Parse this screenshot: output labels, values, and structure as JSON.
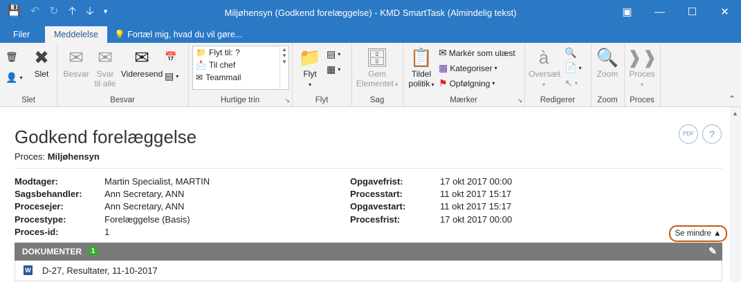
{
  "window": {
    "title": "Miljøhensyn (Godkend forelæggelse) - KMD SmartTask  (Almindelig tekst)"
  },
  "tabs": [
    {
      "label": "Filer"
    },
    {
      "label": "Meddelelse"
    }
  ],
  "tell_me": "Fortæl mig, hvad du vil gøre...",
  "ribbon": {
    "slet": {
      "delete_label": "Slet",
      "group": "Slet"
    },
    "besvar": {
      "reply": "Besvar",
      "reply_all_1": "Svar",
      "reply_all_2": "til alle",
      "forward": "Videresend",
      "group": "Besvar"
    },
    "hurtige": {
      "items": [
        "Flyt til: ?",
        "Til chef",
        "Teammail"
      ],
      "group": "Hurtige trin"
    },
    "flyt": {
      "move": "Flyt",
      "group": "Flyt"
    },
    "sag": {
      "save_1": "Gem",
      "save_2": "Elementet",
      "group": "Sag"
    },
    "maerker": {
      "policy_1": "Tildel",
      "policy_2": "politik",
      "mark_unread": "Markér som ulæst",
      "categorize": "Kategoriser",
      "followup": "Opfølgning",
      "group": "Mærker"
    },
    "rediger": {
      "translate": "Oversæt",
      "group": "Redigerer"
    },
    "zoom": {
      "label": "Zoom",
      "group": "Zoom"
    },
    "proces": {
      "label": "Proces",
      "group": "Proces"
    }
  },
  "task": {
    "title": "Godkend forelæggelse",
    "process_label": "Proces:",
    "process_value": "Miljøhensyn",
    "pdf_label": "PDF",
    "help_label": "?"
  },
  "details_left": [
    {
      "label": "Modtager:",
      "value": "Martin Specialist, MARTIN"
    },
    {
      "label": "Sagsbehandler:",
      "value": "Ann Secretary, ANN"
    },
    {
      "label": "Procesejer:",
      "value": "Ann Secretary, ANN"
    },
    {
      "label": "Procestype:",
      "value": "Forelæggelse (Basis)"
    },
    {
      "label": "Proces-id:",
      "value": "1"
    }
  ],
  "details_right": [
    {
      "label": "Opgavefrist:",
      "value": "17 okt 2017 00:00"
    },
    {
      "label": "Processtart:",
      "value": "11 okt 2017 15:17"
    },
    {
      "label": "Opgavestart:",
      "value": "11 okt 2017 15:17"
    },
    {
      "label": "Procesfrist:",
      "value": "17 okt 2017 00:00"
    }
  ],
  "see_less": "Se mindre",
  "documents": {
    "header": "DOKUMENTER",
    "count": "1",
    "items": [
      {
        "name": "D-27, Resultater, 11-10-2017"
      }
    ]
  },
  "colors": {
    "accent": "#2b78c4",
    "highlight": "#c55a11",
    "badge": "#3aa935"
  }
}
